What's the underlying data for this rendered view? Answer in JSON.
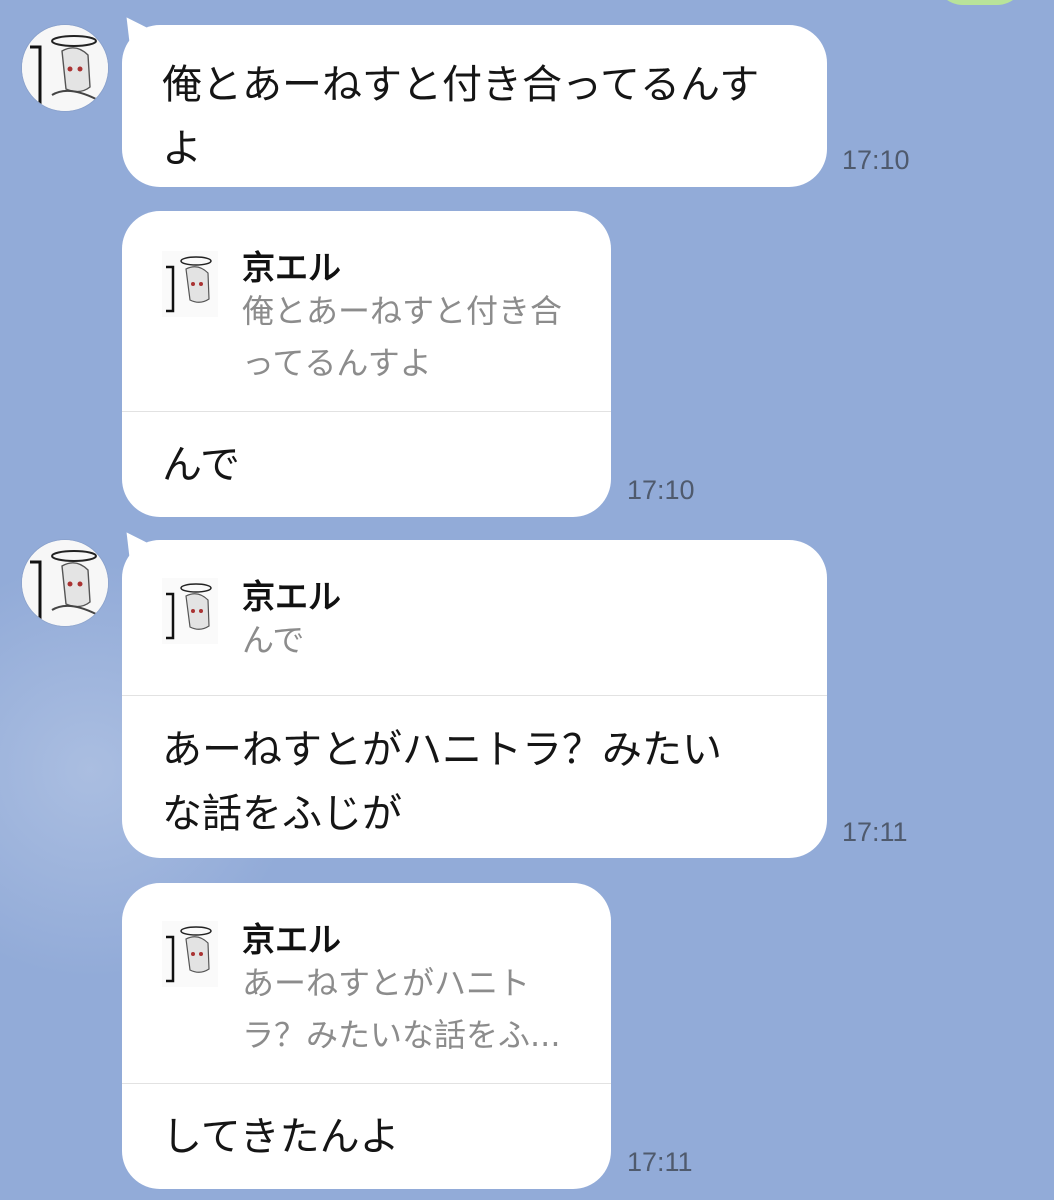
{
  "messages": [
    {
      "text": "俺とあーねすと付き合ってるんす\nよ",
      "time": "17:10"
    },
    {
      "quote": {
        "sender": "京エル",
        "text": "俺とあーねすと付き合\nってるんすよ"
      },
      "text": "んで",
      "time": "17:10"
    },
    {
      "quote": {
        "sender": "京エル",
        "text": "んで"
      },
      "text": "あーねすとがハニトラ？みたい\nな話をふじが",
      "time": "17:11"
    },
    {
      "quote": {
        "sender": "京エル",
        "text": "あーねすとがハニト\nラ？みたいな話をふ..."
      },
      "text": "してきたんよ",
      "time": "17:11"
    }
  ],
  "colors": {
    "background": "#92abd8",
    "bubble": "#ffffff",
    "peek_bubble": "#b8e39a",
    "timestamp": "#4f5a6d",
    "quote_text": "#8c8c8c"
  }
}
